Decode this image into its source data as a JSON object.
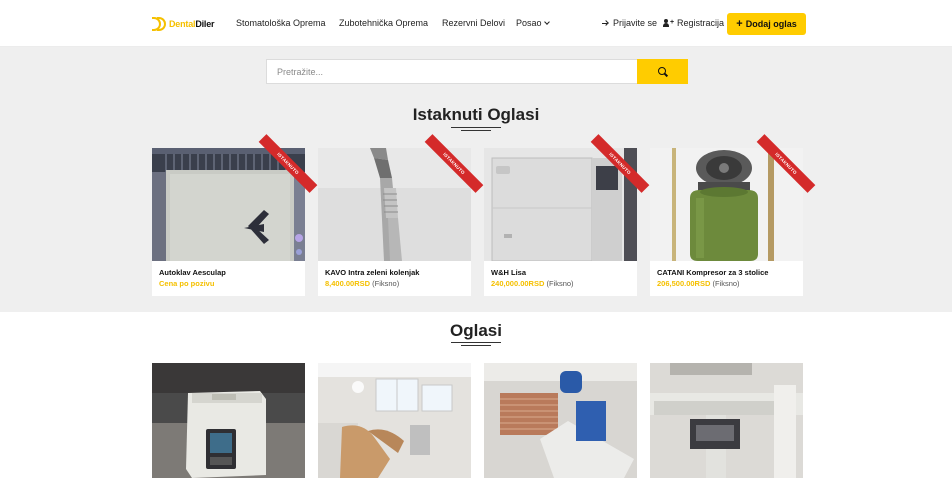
{
  "brand": {
    "logo_part1": "Dental",
    "logo_part2": "Diler"
  },
  "nav": [
    {
      "label": "Stomatološka Oprema"
    },
    {
      "label": "Zubotehnička Oprema"
    },
    {
      "label": "Rezervni Delovi"
    },
    {
      "label": "Posao"
    }
  ],
  "header": {
    "login_label": "Prijavite se",
    "register_label": "Registracija",
    "add_label": "Dodaj oglas"
  },
  "search": {
    "placeholder": "Pretražite..."
  },
  "featured": {
    "title": "Istaknuti Oglasi",
    "ribbon_label": "ISTAKNUTO",
    "items": [
      {
        "name": "Autoklav Aesculap",
        "price": "Cena po pozivu",
        "type": ""
      },
      {
        "name": "KAVO Intra zeleni kolenjak",
        "price": "8,400.00RSD",
        "type": "(Fiksno)"
      },
      {
        "name": "W&H Lisa",
        "price": "240,000.00RSD",
        "type": "(Fiksno)"
      },
      {
        "name": "CATANI Kompresor za 3 stolice",
        "price": "206,500.00RSD",
        "type": "(Fiksno)"
      }
    ]
  },
  "ads": {
    "title": "Oglasi"
  },
  "colors": {
    "accent": "#ffcc00",
    "ribbon": "#d42a2a",
    "band": "#efefef"
  }
}
